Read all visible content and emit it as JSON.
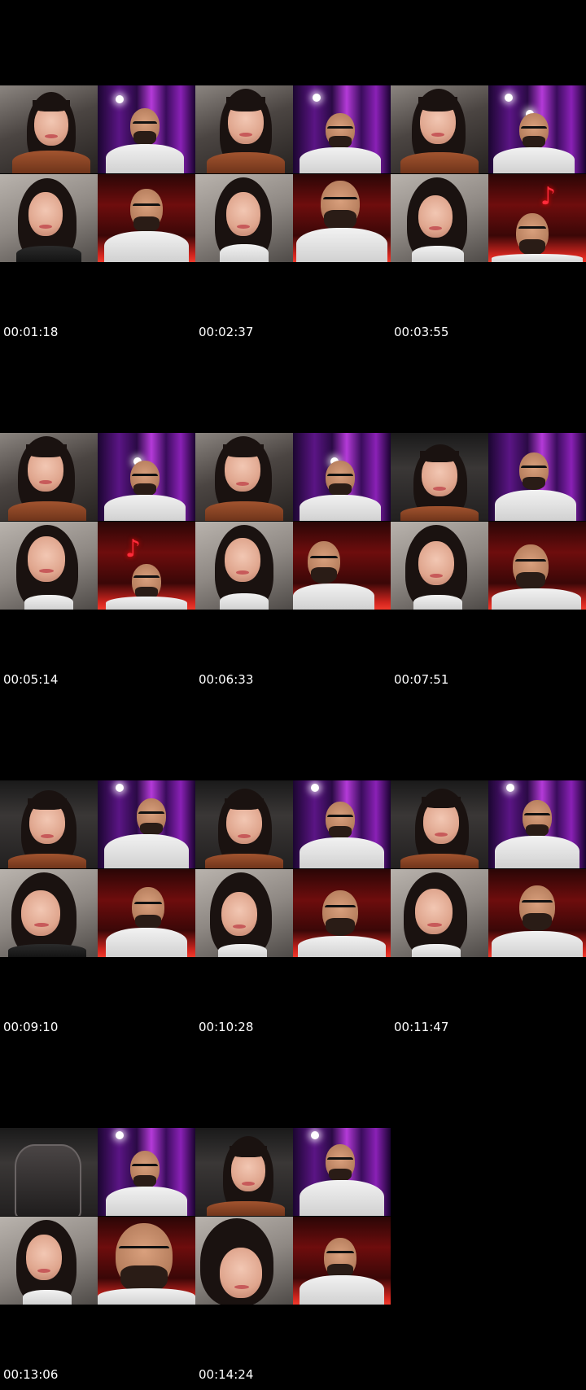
{
  "contact_sheet": {
    "timestamps": [
      "00:01:18",
      "00:02:37",
      "00:03:55",
      "00:05:14",
      "00:06:33",
      "00:07:51",
      "00:09:10",
      "00:10:28",
      "00:11:47",
      "00:13:06",
      "00:14:24"
    ]
  }
}
